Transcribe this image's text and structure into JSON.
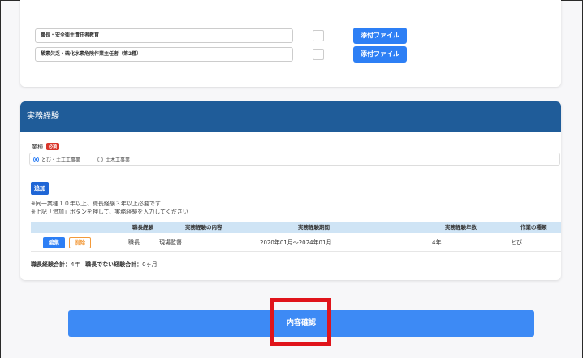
{
  "certifications": [
    {
      "name": "職長・安全衛生責任者教育",
      "attach_label": "添付ファイル"
    },
    {
      "name": "酸素欠乏・硫化水素危険作業主任者（第2種）",
      "attach_label": "添付ファイル"
    }
  ],
  "work_experience": {
    "section_title": "実務経験",
    "industry_label": "業種",
    "required_badge": "必須",
    "industry_options": [
      "とび・土工工事業",
      "土木工事業"
    ],
    "add_button": "追加",
    "notes": [
      "※同一業種１０年以上、職長経験３年以上必要です",
      "※上記「追加」ボタンを押して、実務経験を入力してください"
    ],
    "table": {
      "headers": [
        "職長経験",
        "実務経験の内容",
        "実務経験期間",
        "実務経験年数",
        "作業の種類"
      ],
      "rows": [
        {
          "edit_label": "編集",
          "delete_label": "削除",
          "foreman": "職長",
          "content": "現場監督",
          "period": "2020年01月～2024年01月",
          "years": "4年",
          "work_type": "とび"
        }
      ]
    },
    "totals": {
      "foreman_label": "職長経験合計：",
      "foreman_value": "4年",
      "non_foreman_label": "職長でない経験合計：",
      "non_foreman_value": "0ヶ月"
    }
  },
  "confirm_button": "内容確認",
  "colors": {
    "header_blue": "#1f5c99",
    "button_blue": "#2d7ff5",
    "required_red": "#d9362b",
    "delete_orange": "#f39a3a",
    "highlight_red": "#e0141b"
  }
}
